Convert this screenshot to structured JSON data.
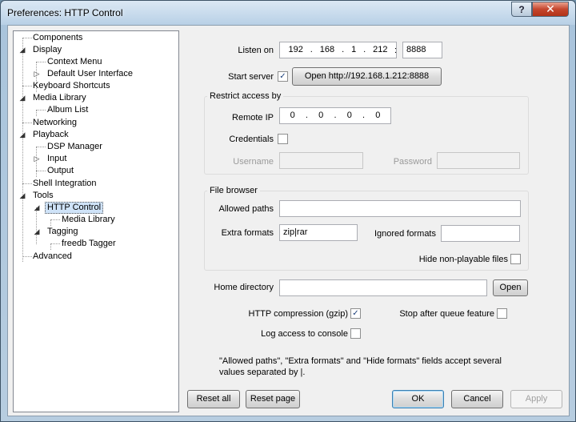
{
  "window": {
    "title": "Preferences: HTTP Control",
    "help_label": "?",
    "close_label": "✕"
  },
  "tree": {
    "items": [
      {
        "label": "Components"
      },
      {
        "label": "Display"
      },
      {
        "label": "Context Menu"
      },
      {
        "label": "Default User Interface"
      },
      {
        "label": "Keyboard Shortcuts"
      },
      {
        "label": "Media Library"
      },
      {
        "label": "Album List"
      },
      {
        "label": "Networking"
      },
      {
        "label": "Playback"
      },
      {
        "label": "DSP Manager"
      },
      {
        "label": "Input"
      },
      {
        "label": "Output"
      },
      {
        "label": "Shell Integration"
      },
      {
        "label": "Tools"
      },
      {
        "label": "HTTP Control"
      },
      {
        "label": "Media Library"
      },
      {
        "label": "Tagging"
      },
      {
        "label": "freedb Tagger"
      },
      {
        "label": "Advanced"
      }
    ],
    "expanded_glyph": "◢",
    "collapsed_glyph": "▷"
  },
  "form": {
    "listen_on_label": "Listen on",
    "ip": [
      "192",
      "168",
      "1",
      "212"
    ],
    "ip_dot": ".",
    "port_sep": ":",
    "port": "8888",
    "start_server_label": "Start server",
    "start_server_checked": "✓",
    "open_button_label": "Open http://192.168.1.212:8888",
    "restrict_group_title": "Restrict access by",
    "remote_ip_label": "Remote IP",
    "remote_ip": [
      "0",
      "0",
      "0",
      "0"
    ],
    "credentials_label": "Credentials",
    "username_label": "Username",
    "username_value": "",
    "password_label": "Password",
    "password_value": "",
    "file_browser_title": "File browser",
    "allowed_paths_label": "Allowed paths",
    "allowed_paths_value": "",
    "extra_formats_label": "Extra formats",
    "extra_formats_value": "zip|rar",
    "ignored_formats_label": "Ignored formats",
    "ignored_formats_value": "",
    "hide_nonplayable_label": "Hide non-playable files",
    "home_directory_label": "Home directory",
    "home_directory_value": "",
    "open_label": "Open",
    "http_compression_label": "HTTP compression (gzip)",
    "http_compression_checked": "✓",
    "stop_after_queue_label": "Stop after queue feature",
    "log_access_label": "Log access to console",
    "note_text": "\"Allowed paths\", \"Extra formats\" and \"Hide formats\" fields accept several values separated by |."
  },
  "buttons": {
    "reset_all": "Reset all",
    "reset_page": "Reset page",
    "ok": "OK",
    "cancel": "Cancel",
    "apply": "Apply"
  }
}
